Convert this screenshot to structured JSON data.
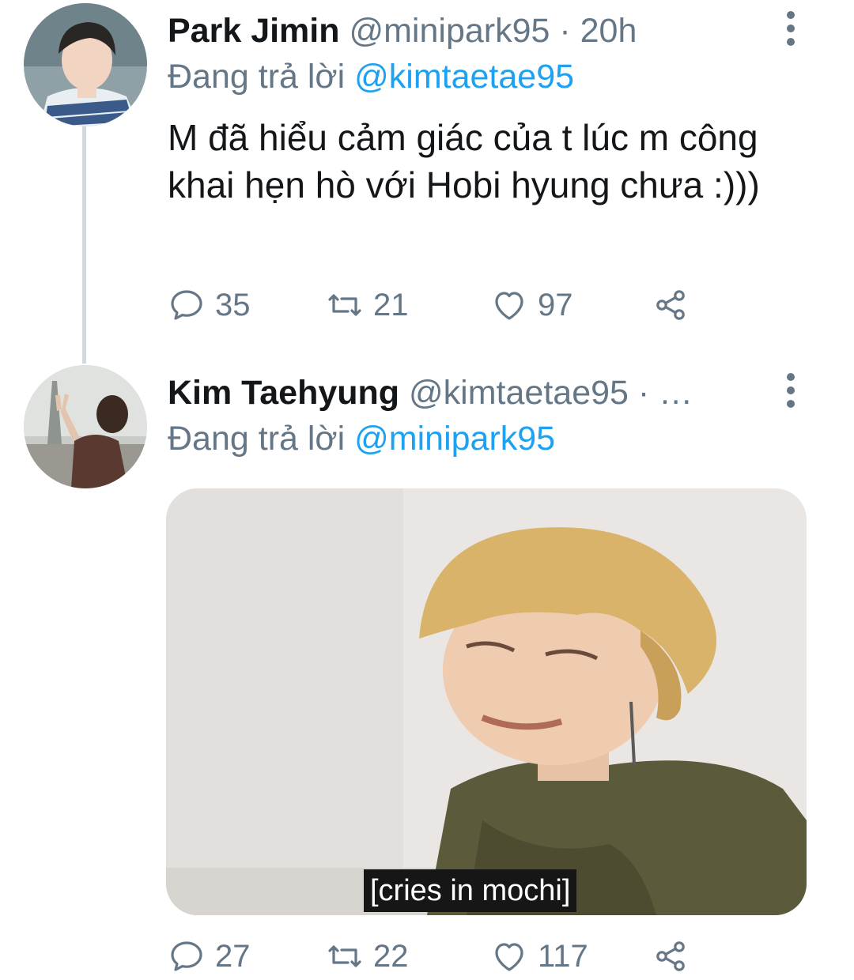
{
  "tweets": [
    {
      "display_name": "Park Jimin",
      "handle": "@minipark95",
      "separator": " · ",
      "time": "20h",
      "reply_prefix": "Đang trả lời ",
      "reply_to": "@kimtaetae95",
      "text": "M đã hiểu cảm giác của t lúc m công khai hẹn hò với Hobi hyung chưa :)))",
      "replies": "35",
      "retweets": "21",
      "likes": "97"
    },
    {
      "display_name": "Kim Taehyung",
      "handle": "@kimtaetae95",
      "separator": " · …",
      "reply_prefix": "Đang trả lời ",
      "reply_to": "@minipark95",
      "media_caption": "[cries in mochi]",
      "replies": "27",
      "retweets": "22",
      "likes": "117"
    }
  ],
  "colors": {
    "text": "#14171a",
    "secondary": "#657786",
    "link": "#1da1f2",
    "thread_line": "#cfd9de"
  },
  "icons": [
    "more-vertical-icon",
    "reply-icon",
    "retweet-icon",
    "like-icon",
    "share-icon"
  ]
}
